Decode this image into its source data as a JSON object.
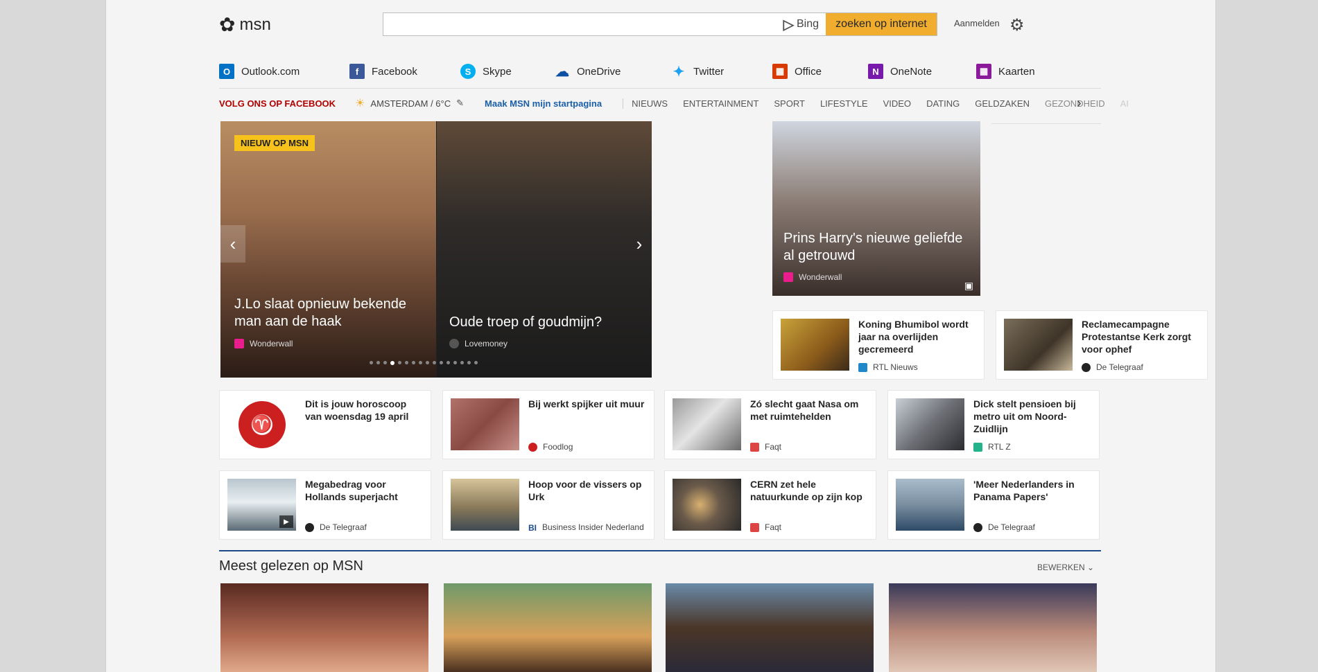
{
  "header": {
    "logo_text": "msn",
    "search_placeholder": "",
    "bing_label": "Bing",
    "search_button": "zoeken op internet",
    "signin": "Aanmelden"
  },
  "apps": [
    {
      "label": "Outlook.com",
      "color": "#0072c6",
      "icon": "outlook-icon"
    },
    {
      "label": "Facebook",
      "color": "#3b5998",
      "icon": "facebook-icon"
    },
    {
      "label": "Skype",
      "color": "#00aff0",
      "icon": "skype-icon"
    },
    {
      "label": "OneDrive",
      "color": "#0a4fa3",
      "icon": "onedrive-icon"
    },
    {
      "label": "Twitter",
      "color": "#1da1f2",
      "icon": "twitter-icon"
    },
    {
      "label": "Office",
      "color": "#d83b01",
      "icon": "office-icon"
    },
    {
      "label": "OneNote",
      "color": "#7719aa",
      "icon": "onenote-icon"
    },
    {
      "label": "Kaarten",
      "color": "#8b1a9a",
      "icon": "maps-icon"
    }
  ],
  "nav": {
    "follow": "VOLG ONS OP FACEBOOK",
    "weather": "AMSTERDAM / 6°C",
    "start": "Maak MSN mijn startpagina",
    "categories": [
      "NIEUWS",
      "ENTERTAINMENT",
      "SPORT",
      "LIFESTYLE",
      "VIDEO",
      "DATING",
      "GELDZAKEN",
      "GEZONDHEID",
      "AI"
    ]
  },
  "hero": {
    "badge": "NIEUW OP MSN",
    "slide1_title": "J.Lo slaat opnieuw bekende man aan de haak",
    "slide1_source": "Wonderwall",
    "slide2_title": "Oude troep of goudmijn?",
    "slide2_source": "Lovemoney",
    "dot_count": 16,
    "active_dot": 3
  },
  "feature": {
    "title": "Prins Harry's nieuwe geliefde al getrouwd",
    "source": "Wonderwall"
  },
  "cards": [
    {
      "title": "Koning Bhumibol wordt jaar na overlijden gecremeerd",
      "source": "RTL Nieuws",
      "color": "#1e88c8"
    },
    {
      "title": "Reclamecampagne Protestantse Kerk zorgt voor ophef",
      "source": "De Telegraaf",
      "color": "#222222"
    },
    {
      "title": "Dit is jouw horoscoop van woensdag 19 april",
      "source": "",
      "color": "#cc1f1f"
    },
    {
      "title": "Bij werkt spijker uit muur",
      "source": "Foodlog",
      "color": "#cc1f1f"
    },
    {
      "title": "Zó slecht gaat Nasa om met ruimtehelden",
      "source": "Faqt",
      "color": "#d44"
    },
    {
      "title": "Dick stelt pensioen bij metro uit om Noord-Zuidlijn",
      "source": "RTL Z",
      "color": "#22b38b"
    },
    {
      "title": "Megabedrag voor Hollands superjacht",
      "source": "De Telegraaf",
      "color": "#222222"
    },
    {
      "title": "Hoop voor de vissers op Urk",
      "source": "Business Insider Nederland",
      "color": "#1a4a8a"
    },
    {
      "title": "CERN zet hele natuurkunde op zijn kop",
      "source": "Faqt",
      "color": "#d44"
    },
    {
      "title": "'Meer Nederlanders in Panama Papers'",
      "source": "De Telegraaf",
      "color": "#222222"
    }
  ],
  "most_read": {
    "title": "Meest gelezen op MSN",
    "edit": "BEWERKEN"
  }
}
